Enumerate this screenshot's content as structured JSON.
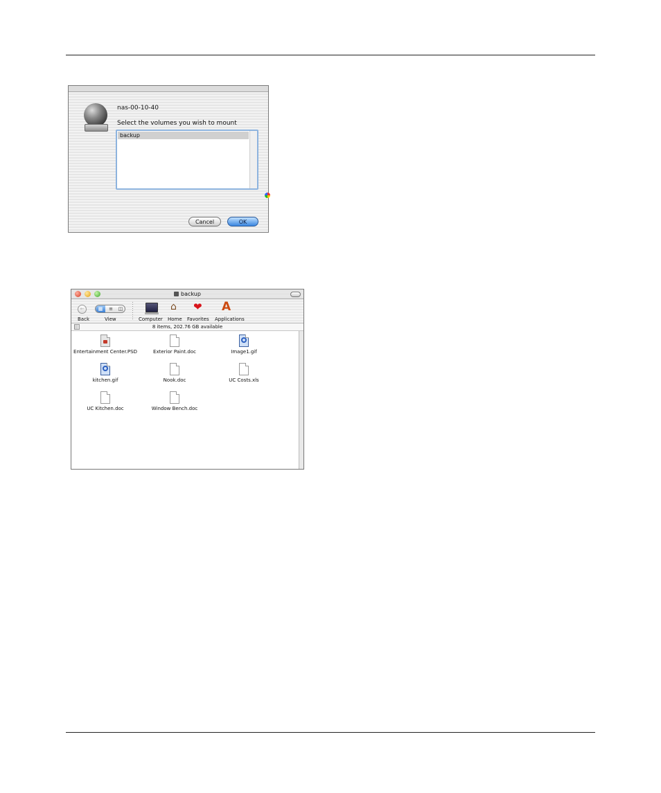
{
  "dialog": {
    "server_name": "nas-00-10-40",
    "prompt": "Select the volumes you wish to mount",
    "volumes": [
      "backup"
    ],
    "cancel_label": "Cancel",
    "ok_label": "OK"
  },
  "finder": {
    "title": "backup",
    "toolbar": {
      "back_label": "Back",
      "view_label": "View",
      "computer_label": "Computer",
      "home_label": "Home",
      "favorites_label": "Favorites",
      "applications_label": "Applications"
    },
    "status": "8 items, 202.76 GB available",
    "files": [
      {
        "name": "Entertainment Center.PSD",
        "type": "psd"
      },
      {
        "name": "Exterior Paint.doc",
        "type": "doc"
      },
      {
        "name": "Image1.gif",
        "type": "gif"
      },
      {
        "name": "kitchen.gif",
        "type": "gif"
      },
      {
        "name": "Nook.doc",
        "type": "doc"
      },
      {
        "name": "UC Costs.xls",
        "type": "doc"
      },
      {
        "name": "UC Kitchen.doc",
        "type": "doc"
      },
      {
        "name": "Window Bench.doc",
        "type": "doc"
      }
    ]
  }
}
